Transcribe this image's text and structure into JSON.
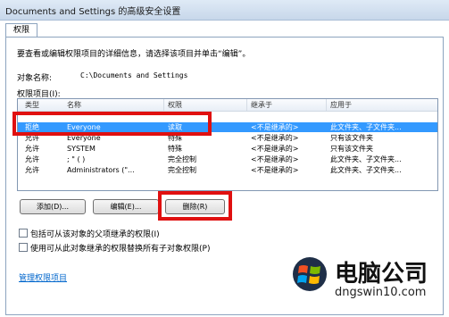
{
  "window": {
    "title": "Documents and Settings 的高级安全设置"
  },
  "tab": {
    "label": "权限"
  },
  "instructions": "要查看或编辑权限项目的详细信息，请选择该项目并单击“编辑”。",
  "object": {
    "label": "对象名称:",
    "value": "C:\\Documents and Settings"
  },
  "list": {
    "label": "权限项目(I):",
    "columns": [
      "类型",
      "名称",
      "权限",
      "继承于",
      "应用于"
    ],
    "rows": [
      [
        "拒绝",
        "Everyone",
        "读取",
        "<不是继承的>",
        "此文件夹、子文件夹..."
      ],
      [
        "允许",
        "Everyone",
        "特殊",
        "<不是继承的>",
        "只有该文件夹"
      ],
      [
        "允许",
        "SYSTEM",
        "特殊",
        "<不是继承的>",
        "只有该文件夹"
      ],
      [
        "允许",
        "; \" (  )",
        "完全控制",
        "<不是继承的>",
        "此文件夹、子文件夹..."
      ],
      [
        "允许",
        "Administrators (\"...",
        "完全控制",
        "<不是继承的>",
        "此文件夹、子文件夹..."
      ]
    ]
  },
  "buttons": {
    "add": "添加(D)...",
    "edit": "编辑(E)...",
    "delete": "删除(R)"
  },
  "checkboxes": {
    "inherit": "包括可从该对象的父项继承的权限(I)",
    "replace": "使用可从此对象继承的权限替换所有子对象权限(P)"
  },
  "link": "管理权限项目",
  "watermark": {
    "brand": "电脑公司",
    "url": "dngswin10.com"
  },
  "colors": {
    "highlight": "#e01010",
    "selection": "#3399ff"
  }
}
